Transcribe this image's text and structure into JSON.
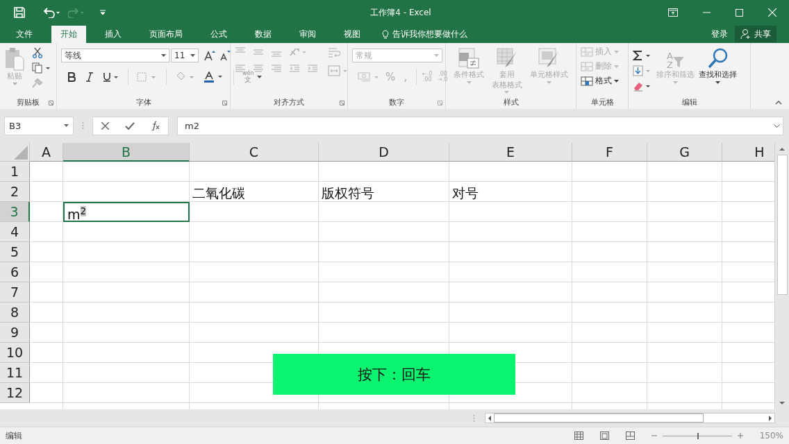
{
  "title_bar": {
    "title": "工作簿4 - Excel",
    "redo": {
      "disabled": true
    }
  },
  "menu_tabs": [
    {
      "label": "文件",
      "selected": false
    },
    {
      "label": "开始",
      "selected": true
    },
    {
      "label": "插入",
      "selected": false
    },
    {
      "label": "页面布局",
      "selected": false
    },
    {
      "label": "公式",
      "selected": false
    },
    {
      "label": "数据",
      "selected": false
    },
    {
      "label": "审阅",
      "selected": false
    },
    {
      "label": "视图",
      "selected": false
    }
  ],
  "tell_me": "告诉我你想要做什么",
  "sign_in": "登录",
  "share": "共享",
  "ribbon": {
    "clipboard": {
      "label": "剪贴板",
      "paste": {
        "label": "粘贴",
        "disabled": true
      },
      "cut": {
        "disabled": false
      },
      "copy": {
        "disabled": false
      },
      "painter": {
        "disabled": true
      }
    },
    "font": {
      "label": "字体",
      "font_name": "等线",
      "font_size": "11",
      "phonetic": {
        "top": "wén",
        "bottom": "文"
      }
    },
    "alignment": {
      "label": "对齐方式"
    },
    "number": {
      "label": "数字",
      "format": "常规",
      "percent": "%",
      "comma": ",",
      "decimals": [
        {
          "top": "←.0",
          "bottom": ".00"
        },
        {
          "top": ".00",
          "bottom": "→.0"
        }
      ]
    },
    "styles": {
      "label": "样式",
      "buttons": [
        {
          "lines": [
            "条件格式"
          ],
          "disabled": true
        },
        {
          "lines": [
            "套用",
            "表格格式"
          ],
          "disabled": true
        },
        {
          "lines": [
            "单元格样式"
          ],
          "disabled": true
        }
      ]
    },
    "cells": {
      "label": "单元格",
      "items": [
        {
          "label": "插入",
          "disabled": true
        },
        {
          "label": "删除",
          "disabled": true
        },
        {
          "label": "格式",
          "disabled": false
        }
      ]
    },
    "editing": {
      "label": "编辑",
      "sort": {
        "label": "排序和筛选",
        "glyphs": [
          "A",
          "Z"
        ],
        "disabled": true
      },
      "find": {
        "label": "查找和选择",
        "disabled": false
      }
    }
  },
  "formula_bar": {
    "name_box": "B3",
    "formula": "m2"
  },
  "grid": {
    "columns": [
      {
        "label": "A",
        "selected": false
      },
      {
        "label": "B",
        "selected": true
      },
      {
        "label": "C",
        "selected": false
      },
      {
        "label": "D",
        "selected": false
      },
      {
        "label": "E",
        "selected": false
      },
      {
        "label": "F",
        "selected": false
      },
      {
        "label": "G",
        "selected": false
      },
      {
        "label": "H",
        "selected": false
      }
    ],
    "rows": [
      {
        "label": "1",
        "selected": false,
        "cells": {}
      },
      {
        "label": "2",
        "selected": false,
        "cells": {
          "C": "二氧化碳",
          "D": "版权符号",
          "E": "对号"
        }
      },
      {
        "label": "3",
        "selected": true,
        "cells": {
          "B": "m$^{2}$"
        }
      },
      {
        "label": "4",
        "selected": false,
        "cells": {}
      },
      {
        "label": "5",
        "selected": false,
        "cells": {}
      },
      {
        "label": "6",
        "selected": false,
        "cells": {}
      },
      {
        "label": "7",
        "selected": false,
        "cells": {}
      },
      {
        "label": "8",
        "selected": false,
        "cells": {}
      },
      {
        "label": "9",
        "selected": false,
        "cells": {}
      },
      {
        "label": "10",
        "selected": false,
        "cells": {}
      },
      {
        "label": "11",
        "selected": false,
        "cells": {}
      },
      {
        "label": "12",
        "selected": false,
        "cells": {}
      }
    ]
  },
  "caption": "按下：回车",
  "status_bar": {
    "mode": "编辑",
    "zoom": "150%",
    "zoom_slider": {
      "level": 0.5
    }
  }
}
